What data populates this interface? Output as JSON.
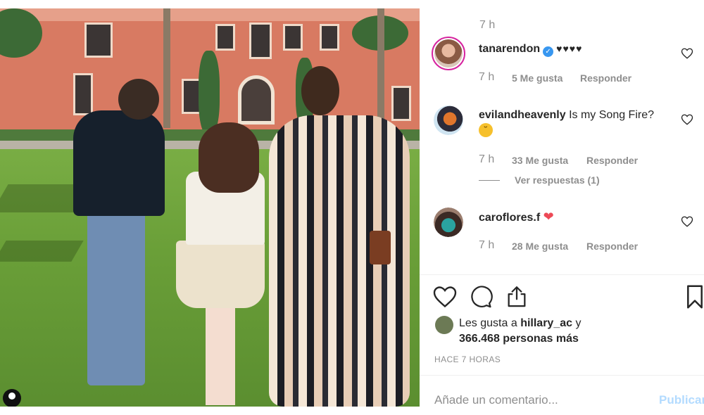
{
  "post": {
    "comments": [
      {
        "username": "tanarendon",
        "verified": true,
        "text": "♥♥♥♥",
        "time": "7 h",
        "likes": "5 Me gusta",
        "reply": "Responder"
      },
      {
        "username": "evilandheavenly",
        "verified": false,
        "text": "Is my Song Fire?",
        "emoji": "😕",
        "time": "7 h",
        "likes": "33 Me gusta",
        "reply": "Responder",
        "view_replies": "Ver respuestas (1)"
      },
      {
        "username": "caroflores.f",
        "verified": false,
        "text": "❤",
        "time": "7 h",
        "likes": "28 Me gusta",
        "reply": "Responder"
      }
    ],
    "top_time": "7 h",
    "liked_by_prefix": "Les gusta a",
    "liked_by_user": "hillary_ac",
    "liked_by_suffix": "y",
    "liked_count": "366.468 personas más",
    "timestamp": "HACE 7 HORAS",
    "comment_placeholder": "Añade un comentario...",
    "publish_label": "Publicar"
  },
  "icons": {
    "like": "heart-outline-icon",
    "comment": "comment-bubble-icon",
    "share": "share-upload-icon",
    "save": "bookmark-icon",
    "comment_like": "heart-small-icon",
    "verified": "verified-badge-icon"
  },
  "colors": {
    "accent_blue": "#3897f0",
    "muted": "#8e8e8e",
    "text": "#262626",
    "heart_red": "#ed4956",
    "publish_disabled": "#b3dbff"
  }
}
